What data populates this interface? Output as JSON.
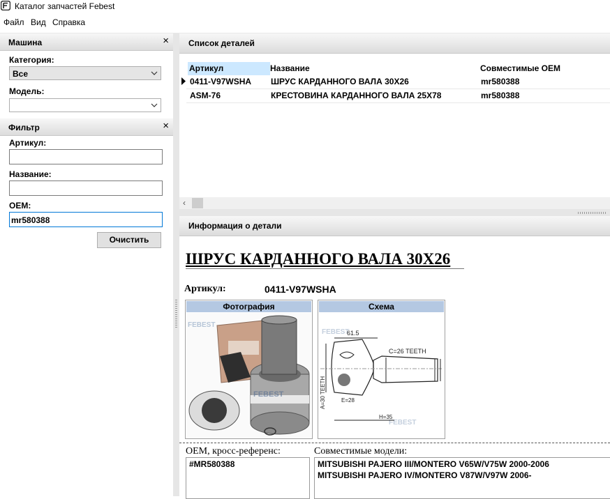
{
  "window": {
    "title": "Каталог запчастей Febest"
  },
  "menu": {
    "items": [
      "Файл",
      "Вид",
      "Справка"
    ]
  },
  "machine_panel": {
    "title": "Машина",
    "close": "×",
    "category_label": "Категория:",
    "category_value": "Все",
    "model_label": "Модель:",
    "model_value": ""
  },
  "filter_panel": {
    "title": "Фильтр",
    "close": "×",
    "article_label": "Артикул:",
    "article_value": "",
    "name_label": "Название:",
    "name_value": "",
    "oem_label": "OEM:",
    "oem_value": "mr580388",
    "clear_button": "Очистить"
  },
  "parts_list": {
    "title": "Список деталей",
    "columns": [
      "Артикул",
      "Название",
      "Совместимые OEM"
    ],
    "rows": [
      {
        "article": "0411-V97WSHA",
        "name": "ШРУС КАРДАННОГО ВАЛА 30X26",
        "oem": "mr580388",
        "selected": true
      },
      {
        "article": "ASM-76",
        "name": "КРЕСТОВИНА КАРДАННОГО ВАЛА 25X78",
        "oem": "mr580388",
        "selected": false
      }
    ]
  },
  "part_info": {
    "title": "Информация о детали",
    "part_name": "ШРУС КАРДАННОГО ВАЛА 30X26",
    "article_label": "Артикул:",
    "article_value": "0411-V97WSHA",
    "photo_caption": "Фотография",
    "scheme_caption": "Схема",
    "scheme_dims": [
      "61.5",
      "C=26 TEETH",
      "A=30 TEETH",
      "E=28",
      "H=35"
    ],
    "oem_cross_label": "OEM, кросс-референс:",
    "oem_cross_value": "#MR580388",
    "compatible_label": "Совместимые модели:",
    "compatible_models": [
      "MITSUBISHI PAJERO III/MONTERO V65W/V75W 2000-2006",
      "MITSUBISHI PAJERO IV/MONTERO V87W/V97W 2006-"
    ]
  },
  "colors": {
    "caption_bg": "#b4c8e2",
    "selection_header": "#cce8ff",
    "focus_border": "#0078d7"
  }
}
